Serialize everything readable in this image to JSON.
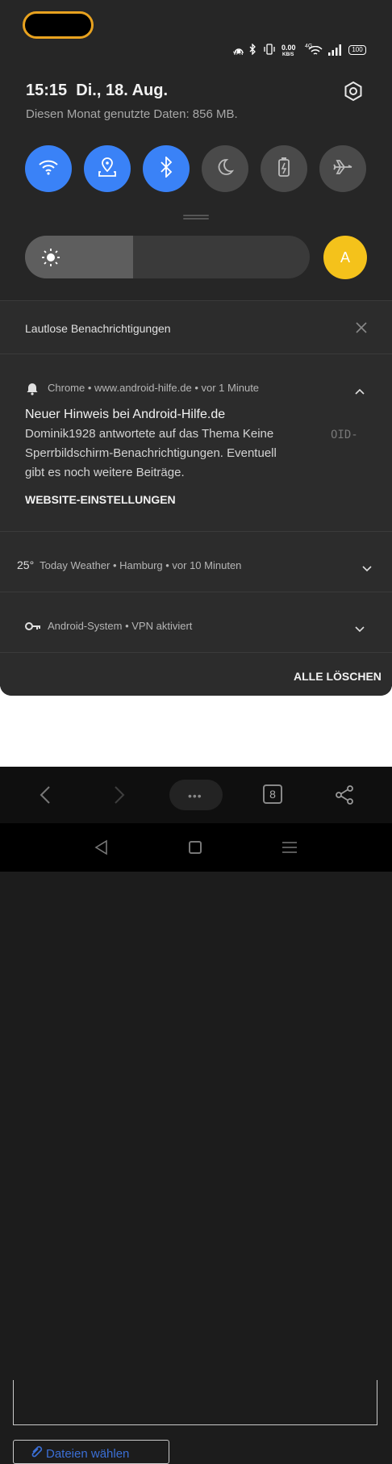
{
  "status_bar": {
    "vpn": "VPN",
    "speed_value": "0.00",
    "speed_unit": "KB/S",
    "net_type": "4G",
    "battery": "100"
  },
  "header": {
    "time": "15:15",
    "date": "Di., 18. Aug.",
    "data_usage": "Diesen Monat genutzte Daten: 856 MB."
  },
  "quick_tiles": [
    {
      "name": "wifi",
      "state": "on",
      "icon": "wifi-icon"
    },
    {
      "name": "location",
      "state": "on",
      "icon": "location-icon"
    },
    {
      "name": "bluetooth",
      "state": "on",
      "icon": "bluetooth-icon"
    },
    {
      "name": "do-not-disturb",
      "state": "off",
      "icon": "moon-icon"
    },
    {
      "name": "battery-saver",
      "state": "off",
      "icon": "battery-icon"
    },
    {
      "name": "airplane-mode",
      "state": "off",
      "icon": "airplane-icon"
    }
  ],
  "brightness": {
    "level": 0.38
  },
  "user": {
    "initial": "A"
  },
  "notifications": {
    "silent_header": "Lautlose Benachrichtigungen",
    "chrome": {
      "app": "Chrome",
      "site": "www.android-hilfe.de",
      "time": "vor 1 Minute",
      "title": "Neuer Hinweis bei Android-Hilfe.de",
      "body_line1": "Dominik1928 antwortete auf das Thema Keine",
      "body_line2": "Sperrbildschirm-Benachrichtigungen. Eventuell",
      "body_line3": "gibt es noch weitere Beiträge.",
      "thumb_text": "OID-",
      "action": "WEBSITE-EINSTELLUNGEN"
    },
    "weather": {
      "temp": "25°",
      "app": "Today Weather",
      "city": "Hamburg",
      "time": "vor 10 Minuten"
    },
    "system": {
      "app": "Android-System",
      "text": "VPN aktiviert"
    },
    "clear_all": "ALLE LÖSCHEN"
  },
  "browser": {
    "tab_count": "8",
    "page_button_label": "Dateien wählen"
  },
  "colors": {
    "accent": "#3a82f7",
    "avatar": "#f4c21b",
    "shade": "#262626"
  }
}
